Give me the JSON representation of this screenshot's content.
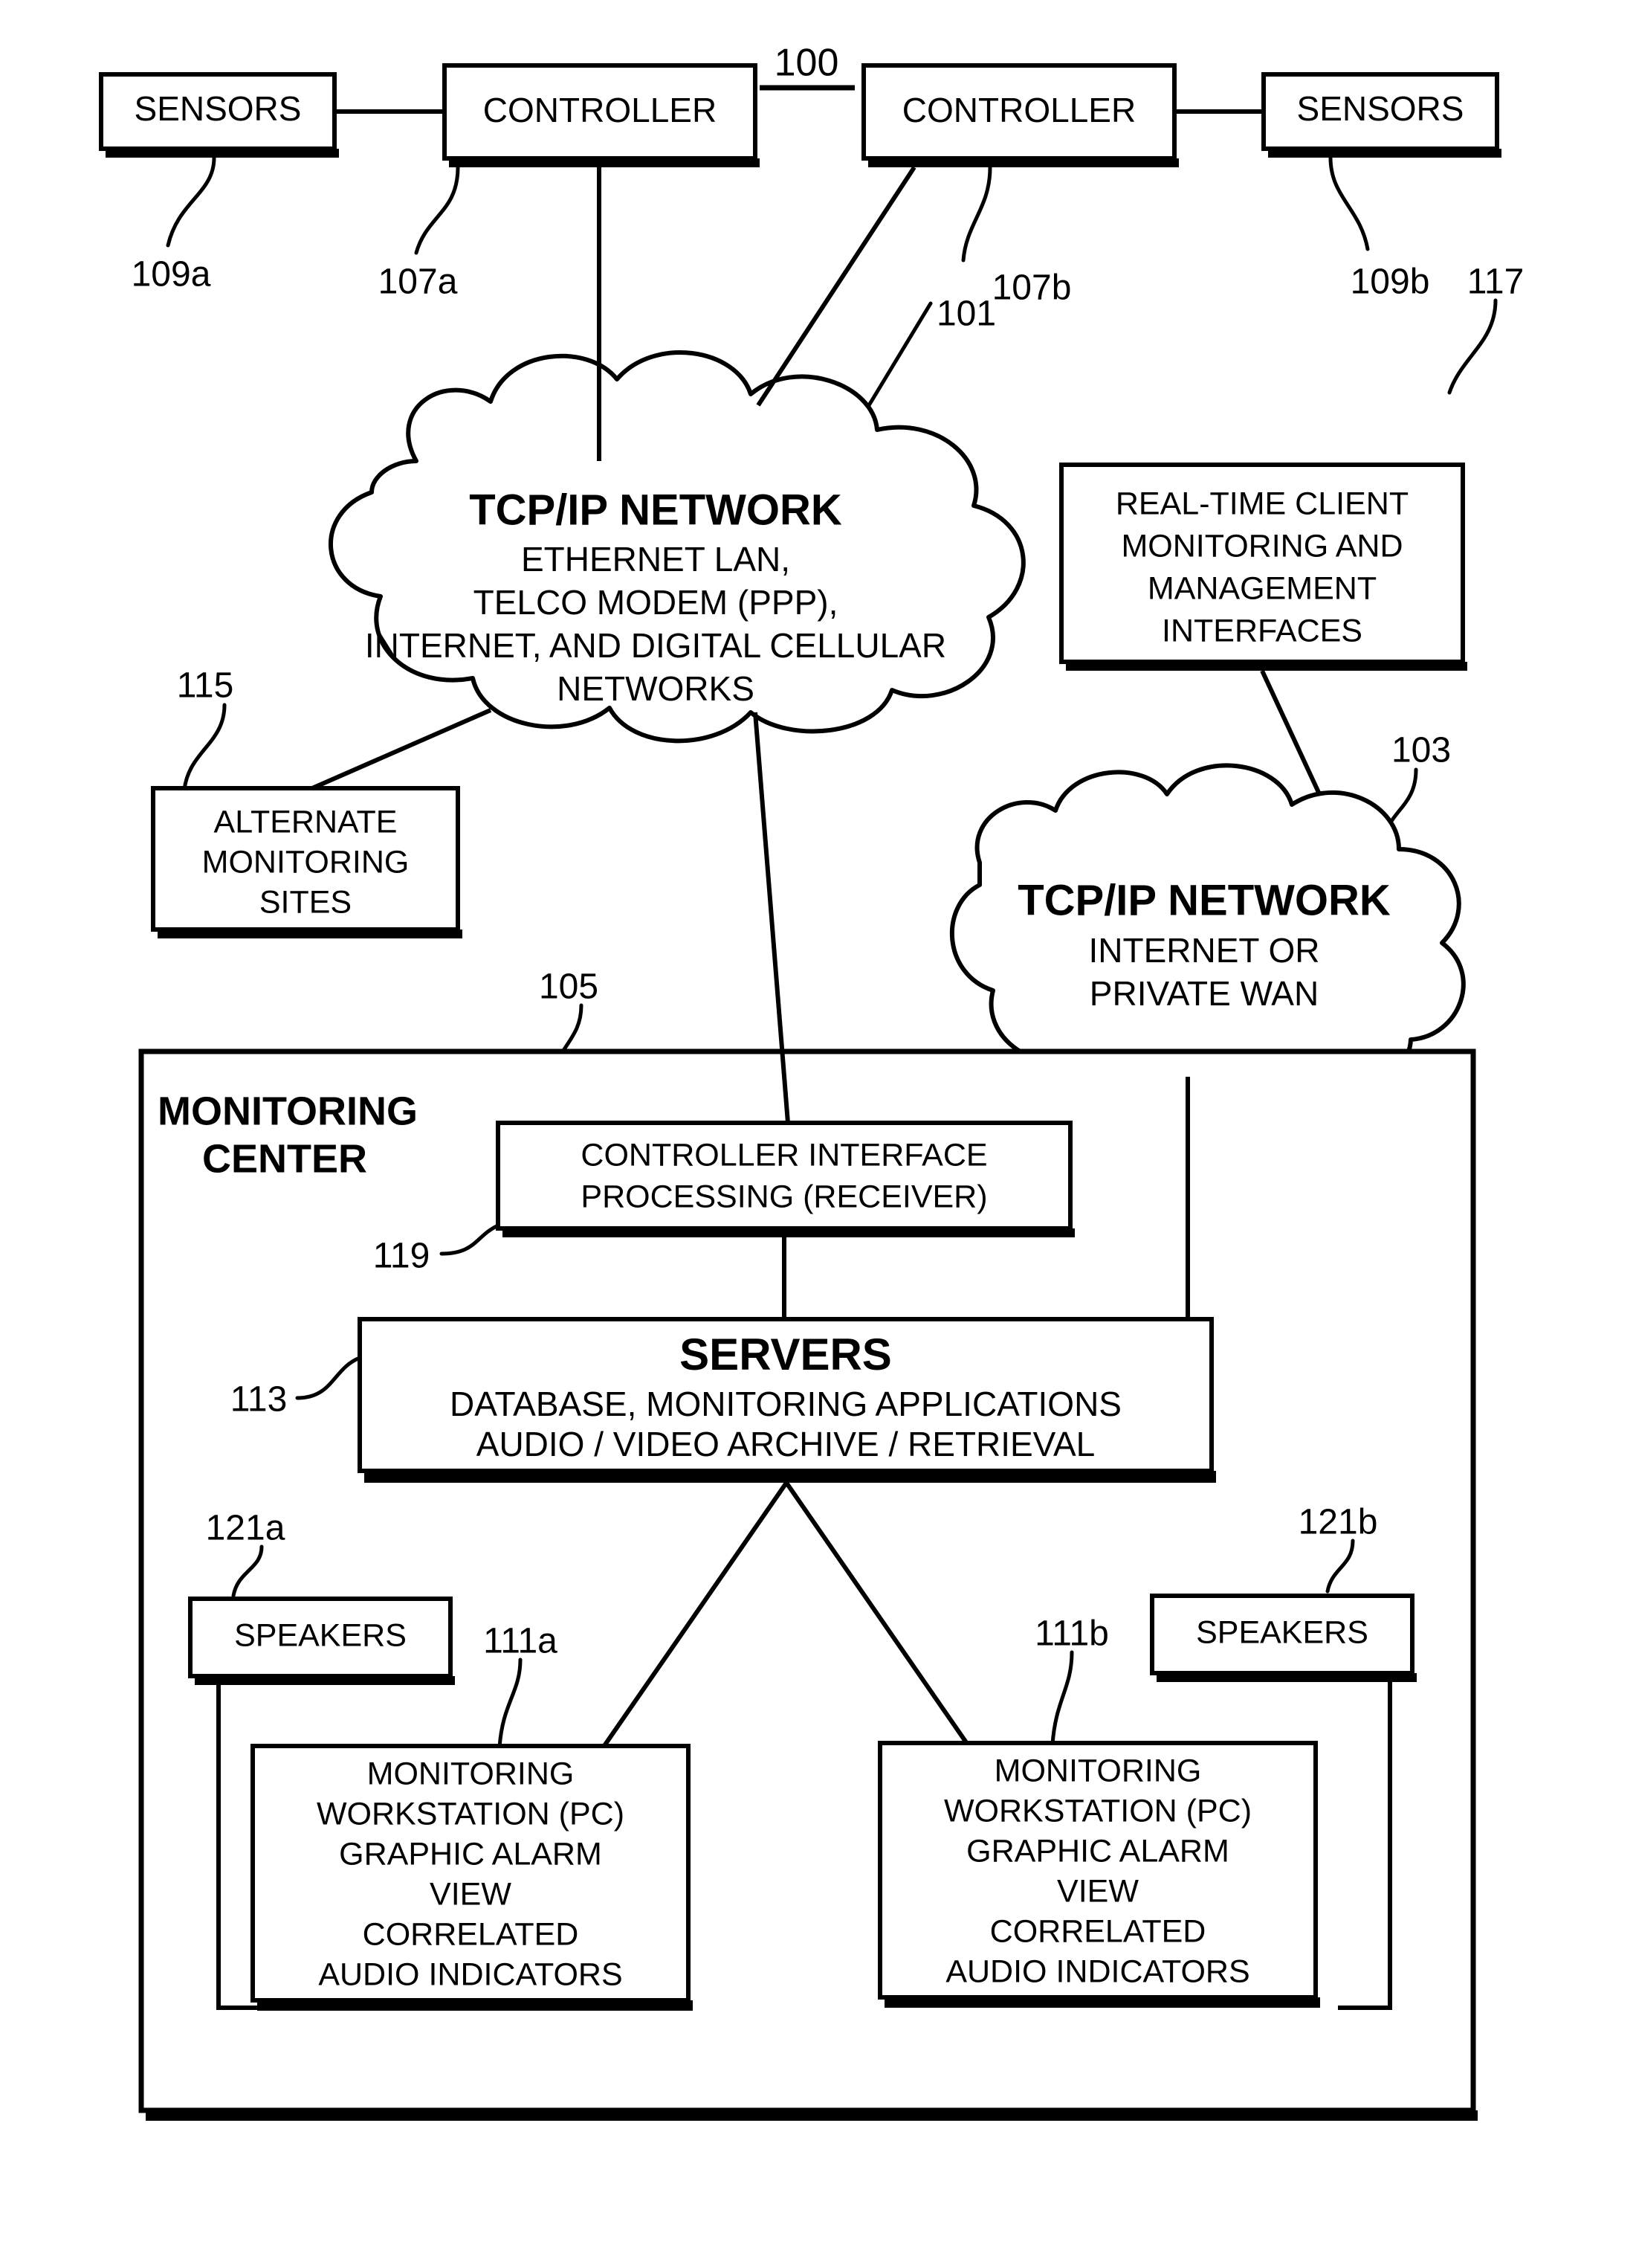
{
  "figure": {
    "number": "100",
    "title_underlined": true
  },
  "blocks": {
    "sensors_left": {
      "label": "SENSORS",
      "ref": "109a"
    },
    "controller_left": {
      "label": "CONTROLLER",
      "ref": "107a"
    },
    "controller_right": {
      "label": "CONTROLLER",
      "ref": "107b"
    },
    "sensors_right": {
      "label": "SENSORS",
      "ref": "109b"
    },
    "realtime_client": {
      "ref": "117",
      "lines": [
        "REAL-TIME CLIENT",
        "MONITORING AND",
        "MANAGEMENT",
        "INTERFACES"
      ]
    },
    "alternate_sites": {
      "ref": "115",
      "lines": [
        "ALTERNATE",
        "MONITORING",
        "SITES"
      ]
    },
    "controller_interface": {
      "ref": "119",
      "lines": [
        "CONTROLLER INTERFACE",
        "PROCESSING (RECEIVER)"
      ]
    },
    "servers": {
      "ref": "113",
      "title": "SERVERS",
      "lines": [
        "DATABASE, MONITORING APPLICATIONS",
        "AUDIO / VIDEO ARCHIVE / RETRIEVAL"
      ]
    },
    "speakers_left": {
      "label": "SPEAKERS",
      "ref": "121a"
    },
    "speakers_right": {
      "label": "SPEAKERS",
      "ref": "121b"
    },
    "workstation_left": {
      "ref": "111a",
      "lines": [
        "MONITORING",
        "WORKSTATION (PC)",
        "GRAPHIC ALARM",
        "VIEW",
        "CORRELATED",
        "AUDIO INDICATORS"
      ]
    },
    "workstation_right": {
      "ref": "111b",
      "lines": [
        "MONITORING",
        "WORKSTATION (PC)",
        "GRAPHIC ALARM",
        "VIEW",
        "CORRELATED",
        "AUDIO INDICATORS"
      ]
    },
    "monitoring_center": {
      "ref": "105",
      "title_lines": [
        "MONITORING",
        "CENTER"
      ]
    }
  },
  "clouds": {
    "network_primary": {
      "ref": "101",
      "title": "TCP/IP NETWORK",
      "lines": [
        "ETHERNET LAN,",
        "TELCO MODEM (PPP),",
        "INTERNET, AND DIGITAL CELLULAR",
        "NETWORKS"
      ]
    },
    "network_secondary": {
      "ref": "103",
      "title": "TCP/IP NETWORK",
      "lines": [
        "INTERNET OR",
        "PRIVATE WAN"
      ]
    }
  },
  "colors": {
    "ink": "#000000",
    "paper": "#ffffff"
  }
}
